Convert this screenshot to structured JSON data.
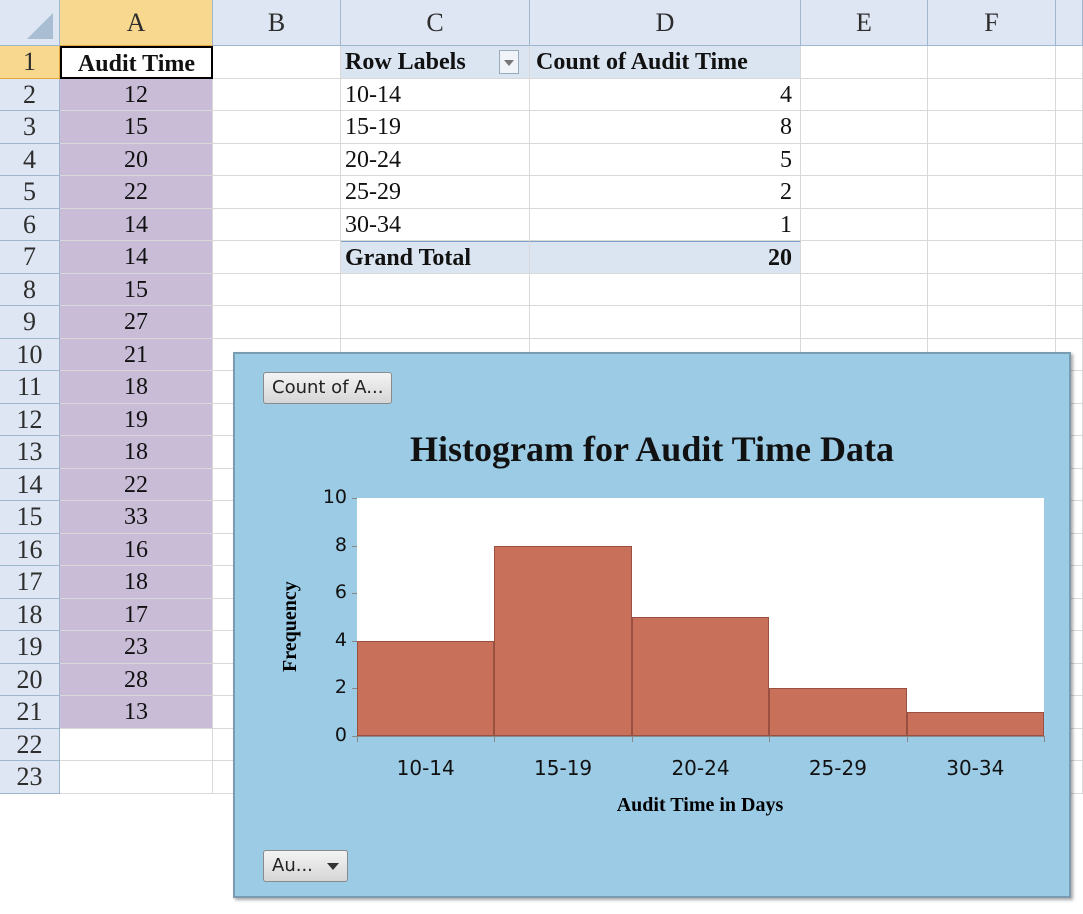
{
  "columns": [
    "A",
    "B",
    "C",
    "D",
    "E",
    "F"
  ],
  "rows": [
    "1",
    "2",
    "3",
    "4",
    "5",
    "6",
    "7",
    "8",
    "9",
    "10",
    "11",
    "12",
    "13",
    "14",
    "15",
    "16",
    "17",
    "18",
    "19",
    "20",
    "21",
    "22",
    "23"
  ],
  "column_a": {
    "header": "Audit Time",
    "values": [
      "12",
      "15",
      "20",
      "22",
      "14",
      "14",
      "15",
      "27",
      "21",
      "18",
      "19",
      "18",
      "22",
      "33",
      "16",
      "18",
      "17",
      "23",
      "28",
      "13"
    ]
  },
  "pivot": {
    "row_labels_header": "Row Labels",
    "count_header": "Count of Audit Time",
    "rows": [
      {
        "label": "10-14",
        "count": "4"
      },
      {
        "label": "15-19",
        "count": "8"
      },
      {
        "label": "20-24",
        "count": "5"
      },
      {
        "label": "25-29",
        "count": "2"
      },
      {
        "label": "30-34",
        "count": "1"
      }
    ],
    "grand_total_label": "Grand Total",
    "grand_total": "20"
  },
  "chart_field_buttons": {
    "value_button": "Count of A...",
    "axis_button": "Au..."
  },
  "chart_data": {
    "type": "bar",
    "title": "Histogram for Audit Time Data",
    "xlabel": "Audit Time in Days",
    "ylabel": "Frequency",
    "categories": [
      "10-14",
      "15-19",
      "20-24",
      "25-29",
      "30-34"
    ],
    "values": [
      4,
      8,
      5,
      2,
      1
    ],
    "ylim": [
      0,
      10
    ],
    "yticks": [
      0,
      2,
      4,
      6,
      8,
      10
    ],
    "grid": false,
    "legend": "none",
    "bar_color": "#c8705a",
    "plot_background": "#ffffff",
    "chart_background": "#9ccbe6"
  },
  "colors": {
    "header_bg": "#dde6f2",
    "selected_header_bg": "#f8d88f",
    "column_a_fill": "#c8bcd7",
    "pivot_header_fill": "#dbe5f1"
  }
}
